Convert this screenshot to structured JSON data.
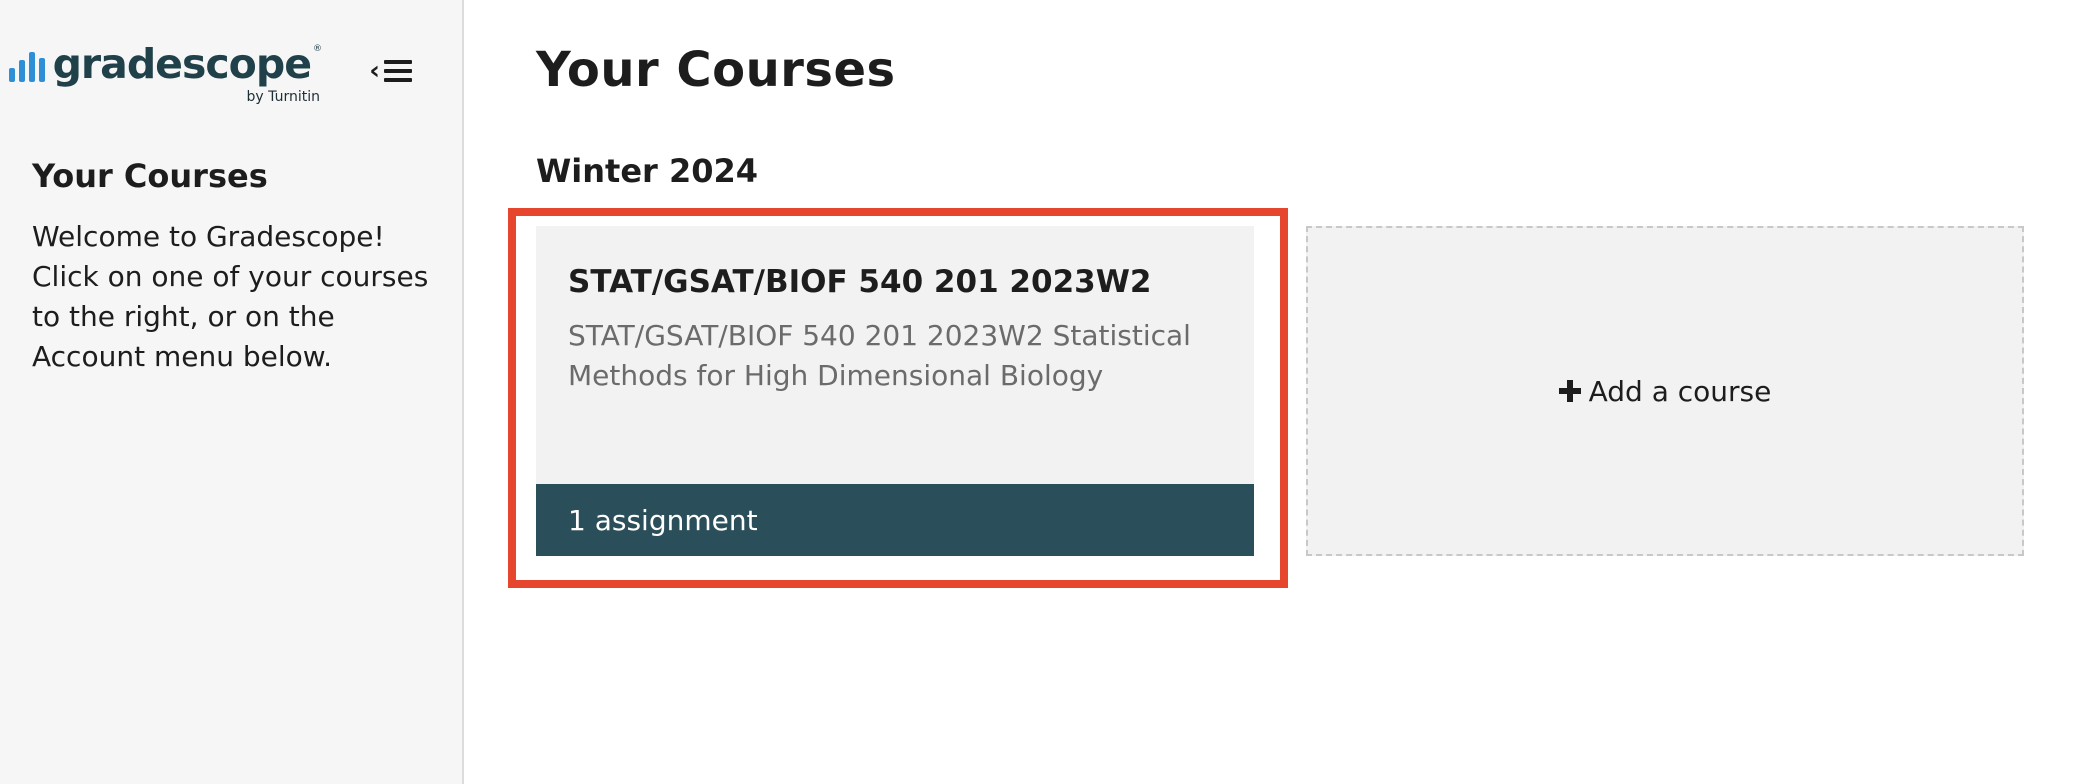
{
  "brand": {
    "wordmark": "gradescope",
    "registered": "®",
    "byline": "by Turnitin",
    "brand_color": "#2f8fd6",
    "wordmark_color": "#20414a"
  },
  "sidebar": {
    "collapse_chevron": "‹",
    "heading": "Your Courses",
    "welcome_text": "Welcome to Gradescope! Click on one of your courses to the right, or on the Account menu below."
  },
  "main": {
    "title": "Your Courses",
    "term": "Winter 2024",
    "courses": [
      {
        "short_name": "STAT/GSAT/BIOF 540 201 2023W2",
        "full_name": "STAT/GSAT/BIOF 540 201 2023W2 Statistical Methods for High Dimensional Biology",
        "assignments": "1 assignment",
        "footer_color": "#2b4f5a"
      }
    ],
    "add_course_label": "Add a course"
  },
  "highlight_color": "#e6452e",
  "icons": {
    "logo": "gradescope-bars-icon",
    "collapse": "collapse-menu-icon",
    "add": "plus-icon"
  }
}
